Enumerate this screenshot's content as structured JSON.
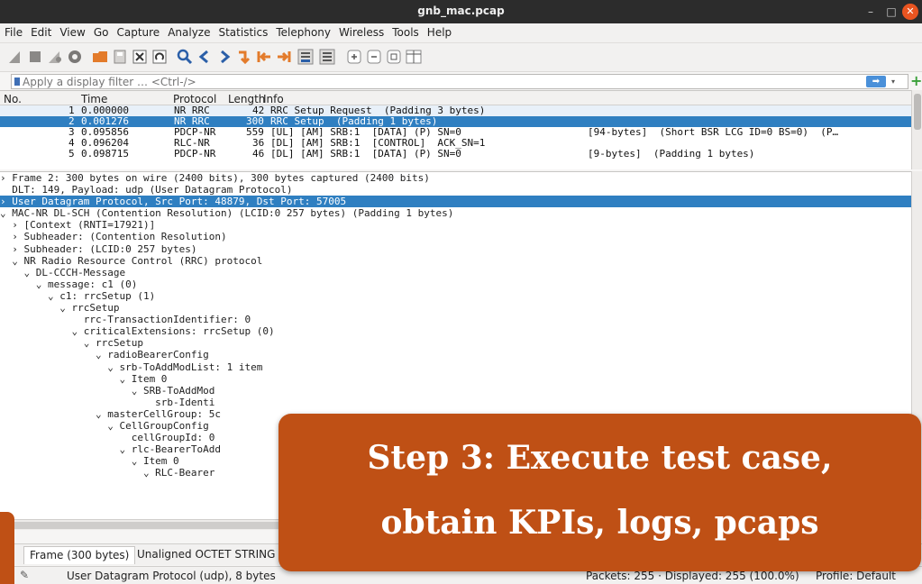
{
  "window": {
    "title": "gnb_mac.pcap"
  },
  "menu": [
    "File",
    "Edit",
    "View",
    "Go",
    "Capture",
    "Analyze",
    "Statistics",
    "Telephony",
    "Wireless",
    "Tools",
    "Help"
  ],
  "filter": {
    "placeholder": "Apply a display filter … <Ctrl-/>"
  },
  "packet_list": {
    "columns": [
      "No.",
      "Time",
      "Protocol",
      "Length",
      "Info"
    ],
    "rows": [
      {
        "no": "1",
        "time": "0.000000",
        "protocol": "NR RRC",
        "length": "42",
        "info": "RRC Setup Request  (Padding 3 bytes)",
        "extra": ""
      },
      {
        "no": "2",
        "time": "0.001276",
        "protocol": "NR RRC",
        "length": "300",
        "info": "RRC Setup  (Padding 1 bytes)",
        "extra": ""
      },
      {
        "no": "3",
        "time": "0.095856",
        "protocol": "PDCP-NR",
        "length": "559",
        "info": "[UL] [AM] SRB:1  [DATA] (P) SN=0",
        "extra": "[94-bytes]  (Short BSR LCG ID=0 BS=0)  (P…"
      },
      {
        "no": "4",
        "time": "0.096204",
        "protocol": "RLC-NR",
        "length": "36",
        "info": "[DL] [AM] SRB:1  [CONTROL]  ACK_SN=1",
        "extra": ""
      },
      {
        "no": "5",
        "time": "0.098715",
        "protocol": "PDCP-NR",
        "length": "46",
        "info": "[DL] [AM] SRB:1  [DATA] (P) SN=0",
        "extra": "[9-bytes]  (Padding 1 bytes)"
      }
    ]
  },
  "details": [
    "› Frame 2: 300 bytes on wire (2400 bits), 300 bytes captured (2400 bits)",
    "  DLT: 149, Payload: udp (User Datagram Protocol)",
    "› User Datagram Protocol, Src Port: 48879, Dst Port: 57005",
    "⌄ MAC-NR DL-SCH (Contention Resolution) (LCID:0 257 bytes) (Padding 1 bytes)",
    "  › [Context (RNTI=17921)]",
    "  › Subheader: (Contention Resolution)",
    "  › Subheader: (LCID:0 257 bytes)",
    "  ⌄ NR Radio Resource Control (RRC) protocol",
    "    ⌄ DL-CCCH-Message",
    "      ⌄ message: c1 (0)",
    "        ⌄ c1: rrcSetup (1)",
    "          ⌄ rrcSetup",
    "              rrc-TransactionIdentifier: 0",
    "            ⌄ criticalExtensions: rrcSetup (0)",
    "              ⌄ rrcSetup",
    "                ⌄ radioBearerConfig",
    "                  ⌄ srb-ToAddModList: 1 item",
    "                    ⌄ Item 0",
    "                      ⌄ SRB-ToAddMod",
    "                          srb-Identi",
    "                ⌄ masterCellGroup: 5c",
    "                  ⌄ CellGroupConfig",
    "                      cellGroupId: 0",
    "                    ⌄ rlc-BearerToAdd",
    "                      ⌄ Item 0",
    "                        ⌄ RLC-Bearer"
  ],
  "bytes_tabs": [
    "Frame (300 bytes)",
    "Unaligned OCTET STRING (25"
  ],
  "status": {
    "left": "User Datagram Protocol (udp), 8 bytes",
    "packets": "Packets: 255 · Displayed: 255 (100.0%)",
    "profile": "Profile: Default"
  },
  "overlay": {
    "line1": "Step 3: Execute test case,",
    "line2": "obtain KPIs, logs, pcaps"
  },
  "colors": {
    "selection": "#2f7fc1",
    "overlay": "#bf5015",
    "titlebar": "#2c2c2c",
    "close": "#e95420"
  }
}
